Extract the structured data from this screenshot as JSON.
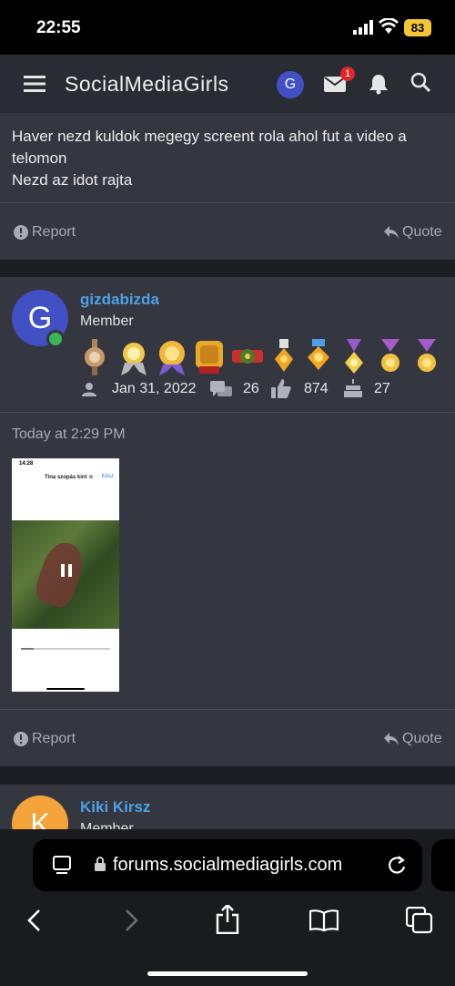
{
  "status_bar": {
    "time": "22:55",
    "battery": "83"
  },
  "header": {
    "title": "SocialMediaGirls",
    "avatar_letter": "G",
    "mail_count": "1"
  },
  "post1": {
    "lines": [
      "Haver nezd kuldok megegy screent rola ahol fut a video a telomon",
      "Nezd az idot rajta"
    ],
    "report_label": "Report",
    "quote_label": "Quote"
  },
  "post2": {
    "avatar_letter": "G",
    "username": "gizdabizda",
    "role": "Member",
    "joined": "Jan 31, 2022",
    "messages": "26",
    "reactions": "874",
    "points": "27",
    "timestamp": "Today at 2:29 PM",
    "report_label": "Report",
    "quote_label": "Quote",
    "attachment": {
      "time": "14:28",
      "title": "Tina szopás kint ☆",
      "done": "Kész"
    }
  },
  "post3": {
    "avatar_letter": "K",
    "username": "Kiki Kirsz",
    "role": "Member"
  },
  "browser": {
    "url": "forums.socialmediagirls.com"
  },
  "colors": {
    "accent": "#4ea0e6",
    "panel": "#353740",
    "avatar_g": "#4150c5",
    "avatar_k": "#f3a33a"
  }
}
